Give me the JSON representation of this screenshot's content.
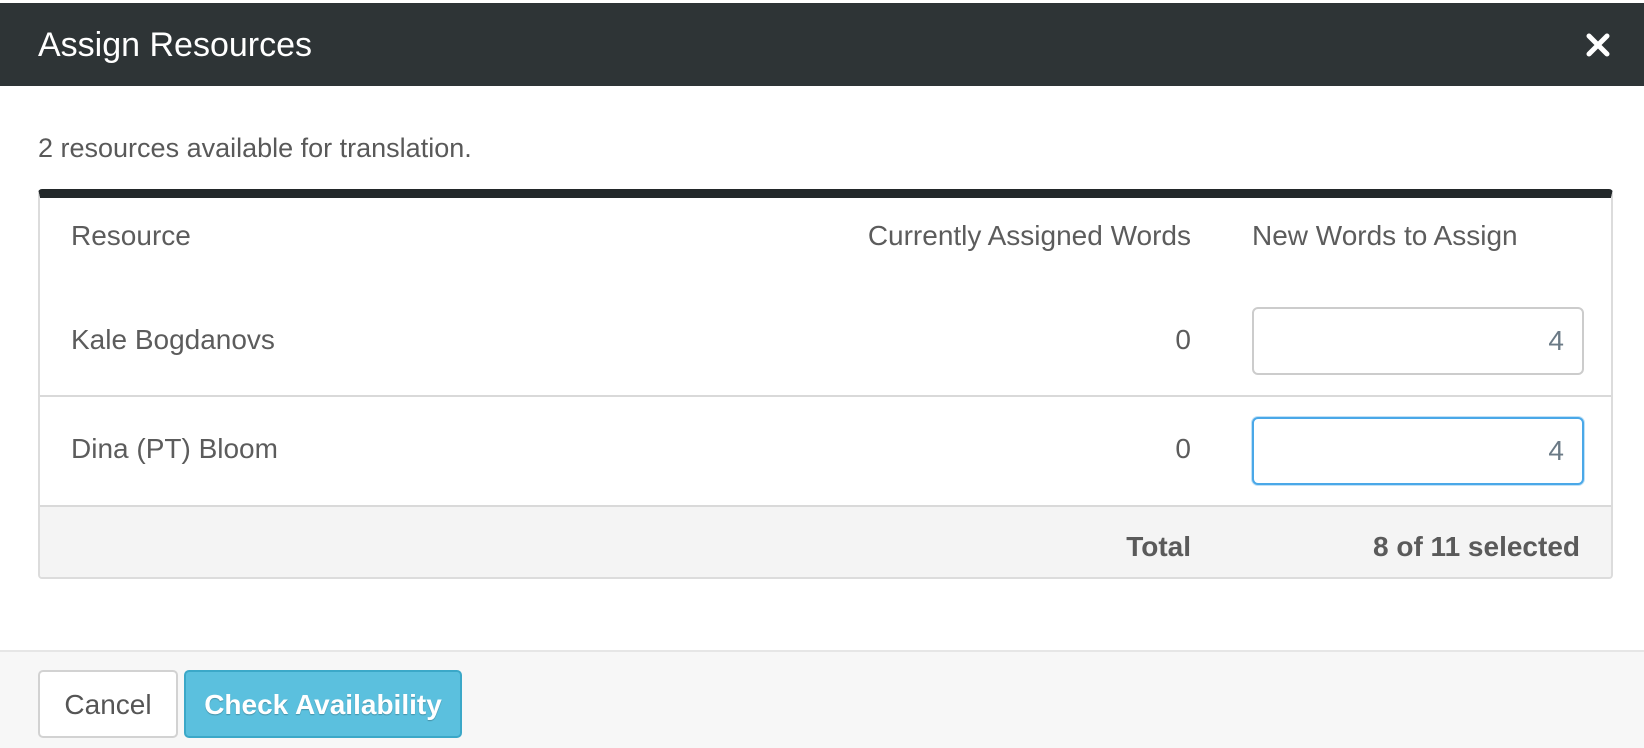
{
  "modal": {
    "title": "Assign Resources",
    "close_icon": "close-icon"
  },
  "intro_text": "2 resources available for translation.",
  "table": {
    "headers": {
      "resource": "Resource",
      "current": "Currently Assigned Words",
      "new": "New Words to Assign"
    },
    "rows": [
      {
        "name": "Kale Bogdanovs",
        "current": "0",
        "new_value": "4"
      },
      {
        "name": "Dina (PT) Bloom",
        "current": "0",
        "new_value": "4"
      }
    ],
    "total": {
      "label": "Total",
      "selected": "8 of 11 selected"
    }
  },
  "footer": {
    "cancel_label": "Cancel",
    "primary_label": "Check Availability"
  },
  "colors": {
    "header_bg": "#2e3436",
    "primary": "#5bc0de",
    "focus": "#4aa8e8"
  }
}
